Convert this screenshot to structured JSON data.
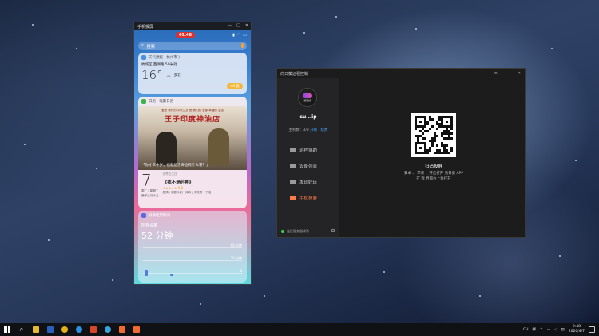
{
  "phone_window": {
    "title": "手机投屏",
    "status_time": "09:48",
    "search_placeholder": "搜索",
    "weather": {
      "header": "天气预报 · 杭州市 〉",
      "location": "杭城区 西湖路 50米处",
      "temperature": "16°",
      "condition": "多云",
      "aqi": "46 良"
    },
    "calendar": {
      "header": "日历 · 电影日历",
      "poster_tagline": "爱是 我们的 平凡生活 是 我们的 全部 幸福的 生活",
      "poster_title": "王子印度神油店",
      "quote": "「你才三十岁，也就想活命也有什么害？」",
      "day": "7",
      "small1": "周二 | 星期二",
      "small2": "庚子三月十五",
      "label": "世界卫生日",
      "film": "《我不是药神》",
      "rating": "★★★★★ 9.0",
      "genre": "剧情 / 喜剧片制 | 徐峥 | 文牧野 | 宁浩"
    },
    "screen_time": {
      "header": "屏幕使用时间",
      "device_label": "所有设备",
      "total": "52 分钟",
      "grid_labels": [
        "60 分钟",
        "30 分钟",
        "0"
      ]
    }
  },
  "remote_window": {
    "title": "向日葵远程控制",
    "avatar_label": "游戏版",
    "username": "su...ip",
    "host_info": "主机数：3/3",
    "host_link1": "升级",
    "host_link2": "续费",
    "menu": [
      {
        "label": "远程协助",
        "active": false
      },
      {
        "label": "设备列表",
        "active": false
      },
      {
        "label": "发现好玩",
        "active": false
      },
      {
        "label": "手机投屏",
        "active": true
      }
    ],
    "connection_status": "连接服务器成功",
    "qr_title": "扫码投屏",
    "qr_desc_line1": "安卓 、 苹果 ：开启打开 向日葵 APP",
    "qr_desc_line2": "在 我 界面右上角打开"
  },
  "taskbar": {
    "tray_lang": "CH",
    "tray_ime": "拼",
    "time": "9:48",
    "date": "2020/4/7"
  }
}
